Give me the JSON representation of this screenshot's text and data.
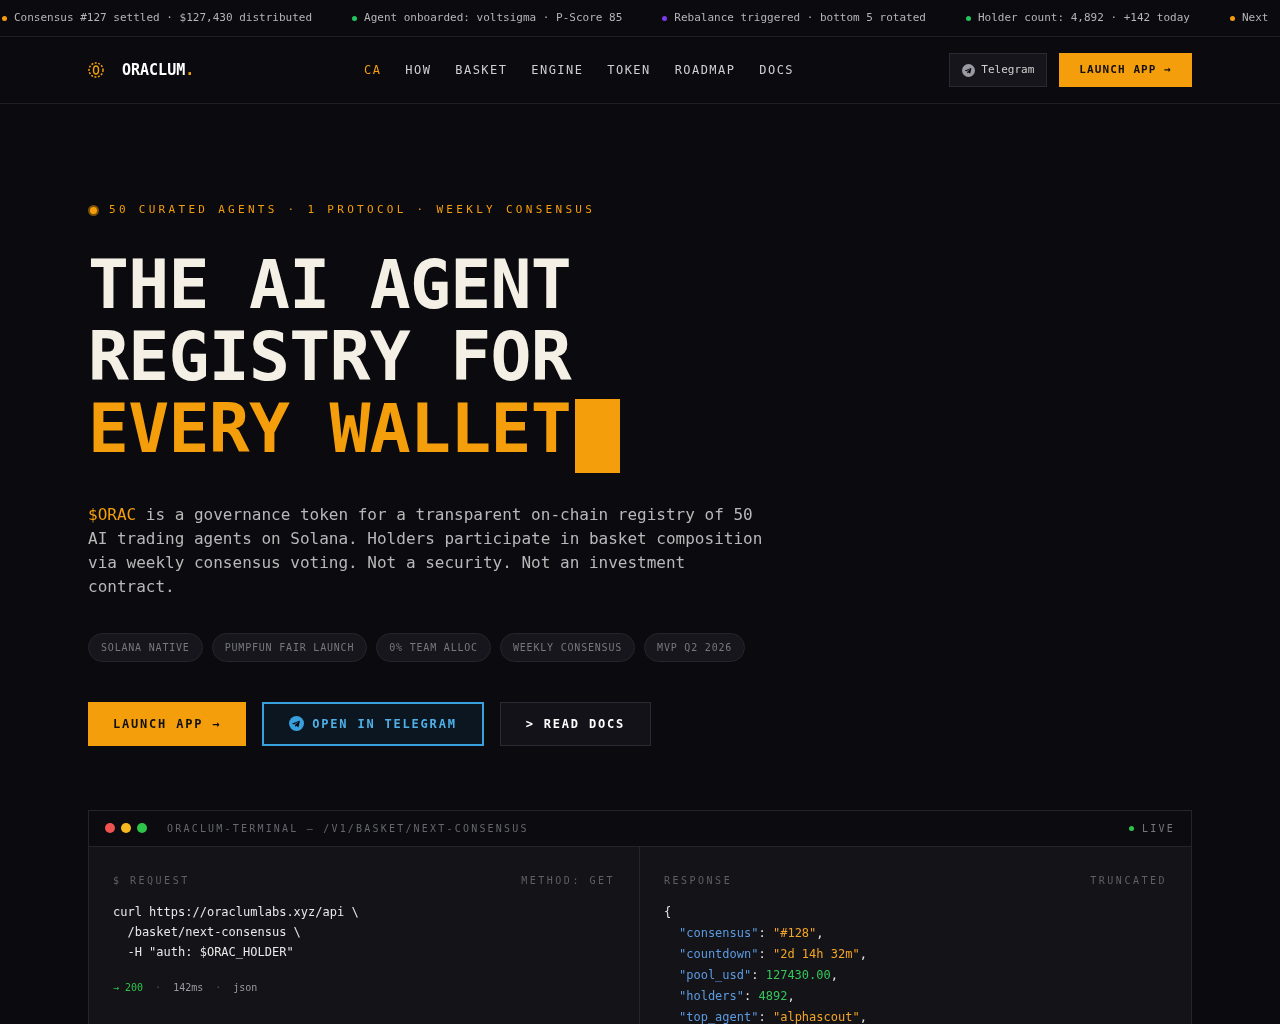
{
  "ticker": [
    {
      "text": "Consensus #127 settled · $127,430 distributed",
      "color": "#f59e0b"
    },
    {
      "text": "Agent onboarded: voltsigma · P-Score 85",
      "color": "#22c55e"
    },
    {
      "text": "Rebalance triggered · bottom 5 rotated",
      "color": "#7c3aed"
    },
    {
      "text": "Holder count: 4,892 · +142 today",
      "color": "#22c55e"
    },
    {
      "text": "Next",
      "color": "#f59e0b"
    }
  ],
  "nav": {
    "brand": "ORACLUM",
    "brand_suffix": ".",
    "links": [
      {
        "label": "CA",
        "selected": true
      },
      {
        "label": "HOW",
        "selected": false
      },
      {
        "label": "BASKET",
        "selected": false
      },
      {
        "label": "ENGINE",
        "selected": false
      },
      {
        "label": "TOKEN",
        "selected": false
      },
      {
        "label": "ROADMAP",
        "selected": false
      },
      {
        "label": "DOCS",
        "selected": false
      }
    ],
    "telegram": "Telegram",
    "launch": "LAUNCH APP →"
  },
  "hero": {
    "eyebrow": "50 CURATED AGENTS · 1 PROTOCOL · WEEKLY CONSENSUS",
    "headline": [
      {
        "text": "THE AI AGENT",
        "accent": false
      },
      {
        "text": "REGISTRY FOR",
        "accent": false
      },
      {
        "text": "EVERY WALLET",
        "accent": true
      }
    ],
    "lead_token": "$ORAC",
    "lead": " is a governance token for a transparent on-chain registry of 50 AI trading agents on Solana. Holders participate in basket composition via weekly consensus voting. Not a security. Not an investment contract.",
    "tags": [
      "SOLANA NATIVE",
      "PUMPFUN FAIR LAUNCH",
      "0% TEAM ALLOC",
      "WEEKLY CONSENSUS",
      "MVP Q2 2026"
    ],
    "buttons": [
      {
        "label": "LAUNCH APP →",
        "kind": "primary"
      },
      {
        "label": "OPEN IN TELEGRAM",
        "kind": "telegram"
      },
      {
        "label": "> READ DOCS",
        "kind": "ghost"
      }
    ]
  },
  "terminal": {
    "title": "ORACLUM-TERMINAL — /V1/BASKET/NEXT-CONSENSUS",
    "status": "LIVE",
    "request": {
      "label": "$ REQUEST",
      "method": "METHOD: GET",
      "lines": [
        "curl https://oraclumlabs.xyz/api \\",
        "  /basket/next-consensus \\",
        "  -H \"auth: $ORAC_HOLDER\""
      ],
      "status_code": "→ 200",
      "separator": "·",
      "timing": "142ms",
      "format": "json"
    },
    "response": {
      "label": "RESPONSE",
      "note": "TRUNCATED",
      "open": "{",
      "colon": ":",
      "comma": ",",
      "fields": [
        {
          "key": "\"consensus\"",
          "value": "\"#128\"",
          "kind": "string"
        },
        {
          "key": "\"countdown\"",
          "value": "\"2d 14h 32m\"",
          "kind": "string"
        },
        {
          "key": "\"pool_usd\"",
          "value": "127430.00",
          "kind": "number"
        },
        {
          "key": "\"holders\"",
          "value": "4892",
          "kind": "number"
        },
        {
          "key": "\"top_agent\"",
          "value": "\"alphascout\"",
          "kind": "string"
        }
      ]
    }
  }
}
